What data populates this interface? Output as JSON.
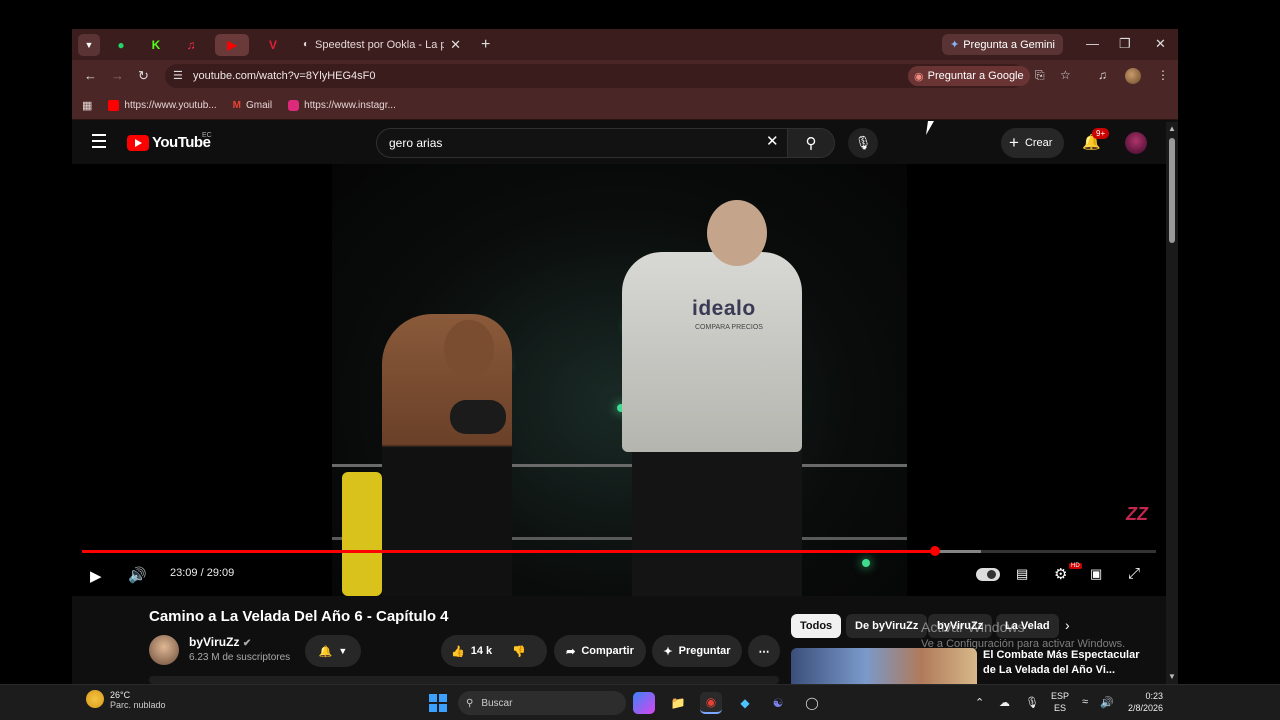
{
  "browser": {
    "tabs": [
      {
        "icon": "whatsapp-icon",
        "color": "#25d366",
        "glyph": "●"
      },
      {
        "icon": "kick-icon",
        "color": "#53fc18",
        "glyph": "K"
      },
      {
        "icon": "music-icon",
        "color": "#fa2d48",
        "glyph": "♫"
      },
      {
        "icon": "youtube-icon",
        "color": "#ff0000",
        "glyph": "▶"
      },
      {
        "icon": "v-icon",
        "color": "#e0203a",
        "glyph": "V"
      }
    ],
    "active_tab_title": "Speedtest por Ookla - La prueb",
    "gemini_label": "Pregunta a Gemini",
    "url": "youtube.com/watch?v=8YlyHEG4sF0",
    "ask_google_label": "Preguntar a Google",
    "bookmarks": [
      {
        "label": "https://www.youtub...",
        "color": "#ff0000"
      },
      {
        "label": "Gmail",
        "color": "#ea4335"
      },
      {
        "label": "https://www.instagr...",
        "color": "#dd2a7b"
      }
    ]
  },
  "youtube": {
    "logo_text": "YouTube",
    "country_code": "EC",
    "search_value": "gero arias",
    "create_label": "Crear",
    "notifications_badge": "9+",
    "player": {
      "overlay_logo": "idealo",
      "overlay_sub": "COMPARA PRECIOS",
      "watermark": "ZZ",
      "current_time": "23:09",
      "duration": "29:09",
      "time_display": "23:09 / 29:09",
      "progress_fraction": 0.794,
      "buffer_fraction": 0.837,
      "hd_badge": "HD"
    },
    "video_title": "Camino a La Velada Del Año 6 - Capítulo 4",
    "channel": {
      "name": "byViruZz",
      "subscribers": "6.23 M de suscriptores"
    },
    "actions": {
      "likes": "14 k",
      "share": "Compartir",
      "ask": "Preguntar"
    },
    "chips": [
      "Todos",
      "De byViruZz",
      "byViruZz",
      "La Velad"
    ],
    "related_title": "El Combate Más Espectacular de La Velada del Año Vi...",
    "windows_watermark_1": "Activar Windows",
    "windows_watermark_2": "Ve a Configuración para activar Windows."
  },
  "taskbar": {
    "temperature": "26°C",
    "weather": "Parc. nublado",
    "search_placeholder": "Buscar",
    "lang1": "ESP",
    "lang2": "ES",
    "time": "0:23",
    "date": "2/8/2026"
  }
}
